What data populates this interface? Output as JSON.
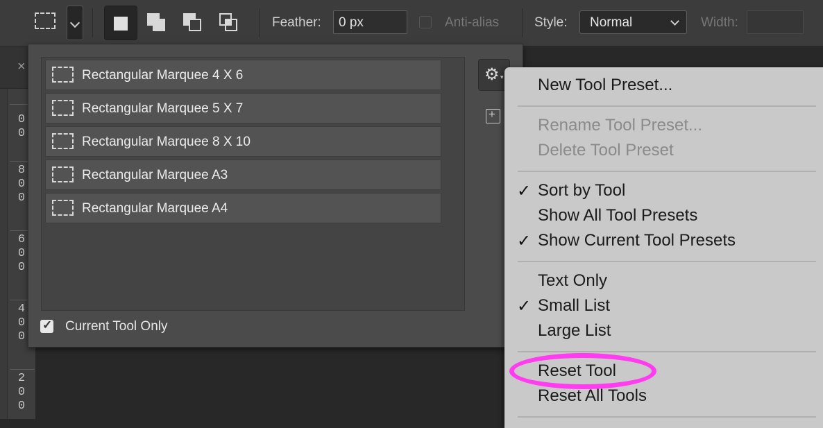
{
  "options_bar": {
    "feather_label": "Feather:",
    "feather_value": "0 px",
    "antialias_label": "Anti-alias",
    "style_label": "Style:",
    "style_value": "Normal",
    "width_label": "Width:"
  },
  "ruler": {
    "marks": [
      [
        "0",
        "0"
      ],
      [
        "8",
        "0",
        "0"
      ],
      [
        "6",
        "0",
        "0"
      ],
      [
        "4",
        "0",
        "0"
      ],
      [
        "2",
        "0",
        "0"
      ]
    ]
  },
  "tab": {
    "close_glyph": "×"
  },
  "preset_panel": {
    "presets": [
      "Rectangular Marquee 4 X 6",
      "Rectangular Marquee 5 X 7",
      "Rectangular Marquee 8 X 10",
      "Rectangular Marquee A3",
      "Rectangular Marquee A4"
    ],
    "current_tool_only_label": "Current Tool Only",
    "current_tool_only_checked": true,
    "gear_glyph": "⚙",
    "new_glyph": "+"
  },
  "menu": {
    "new_tool_preset": "New Tool Preset...",
    "rename_tool_preset": "Rename Tool Preset...",
    "delete_tool_preset": "Delete Tool Preset",
    "sort_by_tool": "Sort by Tool",
    "show_all_tool_presets": "Show All Tool Presets",
    "show_current_tool_presets": "Show Current Tool Presets",
    "text_only": "Text Only",
    "small_list": "Small List",
    "large_list": "Large List",
    "reset_tool": "Reset Tool",
    "reset_all_tools": "Reset All Tools",
    "check_glyph": "✓"
  },
  "colors": {
    "highlight": "#ff3cf0",
    "menu_bg": "#c9c9c9",
    "panel_bg": "#4b4b4b"
  }
}
